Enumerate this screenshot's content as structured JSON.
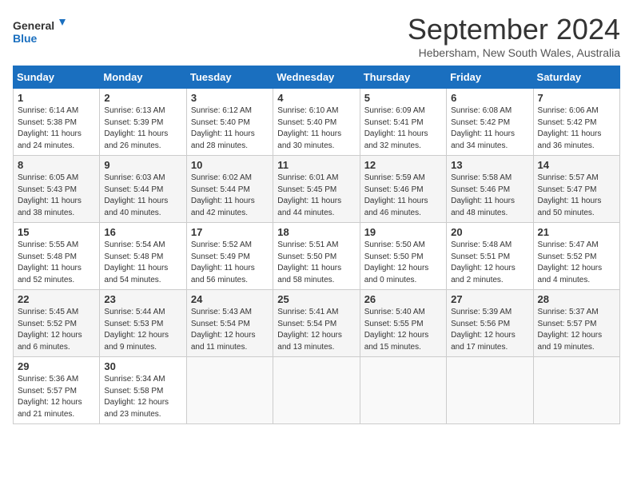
{
  "header": {
    "logo_line1": "General",
    "logo_line2": "Blue",
    "title": "September 2024",
    "subtitle": "Hebersham, New South Wales, Australia"
  },
  "weekdays": [
    "Sunday",
    "Monday",
    "Tuesday",
    "Wednesday",
    "Thursday",
    "Friday",
    "Saturday"
  ],
  "weeks": [
    [
      {
        "day": 1,
        "sunrise": "6:14 AM",
        "sunset": "5:38 PM",
        "daylight": "11 hours and 24 minutes."
      },
      {
        "day": 2,
        "sunrise": "6:13 AM",
        "sunset": "5:39 PM",
        "daylight": "11 hours and 26 minutes."
      },
      {
        "day": 3,
        "sunrise": "6:12 AM",
        "sunset": "5:40 PM",
        "daylight": "11 hours and 28 minutes."
      },
      {
        "day": 4,
        "sunrise": "6:10 AM",
        "sunset": "5:40 PM",
        "daylight": "11 hours and 30 minutes."
      },
      {
        "day": 5,
        "sunrise": "6:09 AM",
        "sunset": "5:41 PM",
        "daylight": "11 hours and 32 minutes."
      },
      {
        "day": 6,
        "sunrise": "6:08 AM",
        "sunset": "5:42 PM",
        "daylight": "11 hours and 34 minutes."
      },
      {
        "day": 7,
        "sunrise": "6:06 AM",
        "sunset": "5:42 PM",
        "daylight": "11 hours and 36 minutes."
      }
    ],
    [
      {
        "day": 8,
        "sunrise": "6:05 AM",
        "sunset": "5:43 PM",
        "daylight": "11 hours and 38 minutes."
      },
      {
        "day": 9,
        "sunrise": "6:03 AM",
        "sunset": "5:44 PM",
        "daylight": "11 hours and 40 minutes."
      },
      {
        "day": 10,
        "sunrise": "6:02 AM",
        "sunset": "5:44 PM",
        "daylight": "11 hours and 42 minutes."
      },
      {
        "day": 11,
        "sunrise": "6:01 AM",
        "sunset": "5:45 PM",
        "daylight": "11 hours and 44 minutes."
      },
      {
        "day": 12,
        "sunrise": "5:59 AM",
        "sunset": "5:46 PM",
        "daylight": "11 hours and 46 minutes."
      },
      {
        "day": 13,
        "sunrise": "5:58 AM",
        "sunset": "5:46 PM",
        "daylight": "11 hours and 48 minutes."
      },
      {
        "day": 14,
        "sunrise": "5:57 AM",
        "sunset": "5:47 PM",
        "daylight": "11 hours and 50 minutes."
      }
    ],
    [
      {
        "day": 15,
        "sunrise": "5:55 AM",
        "sunset": "5:48 PM",
        "daylight": "11 hours and 52 minutes."
      },
      {
        "day": 16,
        "sunrise": "5:54 AM",
        "sunset": "5:48 PM",
        "daylight": "11 hours and 54 minutes."
      },
      {
        "day": 17,
        "sunrise": "5:52 AM",
        "sunset": "5:49 PM",
        "daylight": "11 hours and 56 minutes."
      },
      {
        "day": 18,
        "sunrise": "5:51 AM",
        "sunset": "5:50 PM",
        "daylight": "11 hours and 58 minutes."
      },
      {
        "day": 19,
        "sunrise": "5:50 AM",
        "sunset": "5:50 PM",
        "daylight": "12 hours and 0 minutes."
      },
      {
        "day": 20,
        "sunrise": "5:48 AM",
        "sunset": "5:51 PM",
        "daylight": "12 hours and 2 minutes."
      },
      {
        "day": 21,
        "sunrise": "5:47 AM",
        "sunset": "5:52 PM",
        "daylight": "12 hours and 4 minutes."
      }
    ],
    [
      {
        "day": 22,
        "sunrise": "5:45 AM",
        "sunset": "5:52 PM",
        "daylight": "12 hours and 6 minutes."
      },
      {
        "day": 23,
        "sunrise": "5:44 AM",
        "sunset": "5:53 PM",
        "daylight": "12 hours and 9 minutes."
      },
      {
        "day": 24,
        "sunrise": "5:43 AM",
        "sunset": "5:54 PM",
        "daylight": "12 hours and 11 minutes."
      },
      {
        "day": 25,
        "sunrise": "5:41 AM",
        "sunset": "5:54 PM",
        "daylight": "12 hours and 13 minutes."
      },
      {
        "day": 26,
        "sunrise": "5:40 AM",
        "sunset": "5:55 PM",
        "daylight": "12 hours and 15 minutes."
      },
      {
        "day": 27,
        "sunrise": "5:39 AM",
        "sunset": "5:56 PM",
        "daylight": "12 hours and 17 minutes."
      },
      {
        "day": 28,
        "sunrise": "5:37 AM",
        "sunset": "5:57 PM",
        "daylight": "12 hours and 19 minutes."
      }
    ],
    [
      {
        "day": 29,
        "sunrise": "5:36 AM",
        "sunset": "5:57 PM",
        "daylight": "12 hours and 21 minutes."
      },
      {
        "day": 30,
        "sunrise": "5:34 AM",
        "sunset": "5:58 PM",
        "daylight": "12 hours and 23 minutes."
      },
      null,
      null,
      null,
      null,
      null
    ]
  ]
}
